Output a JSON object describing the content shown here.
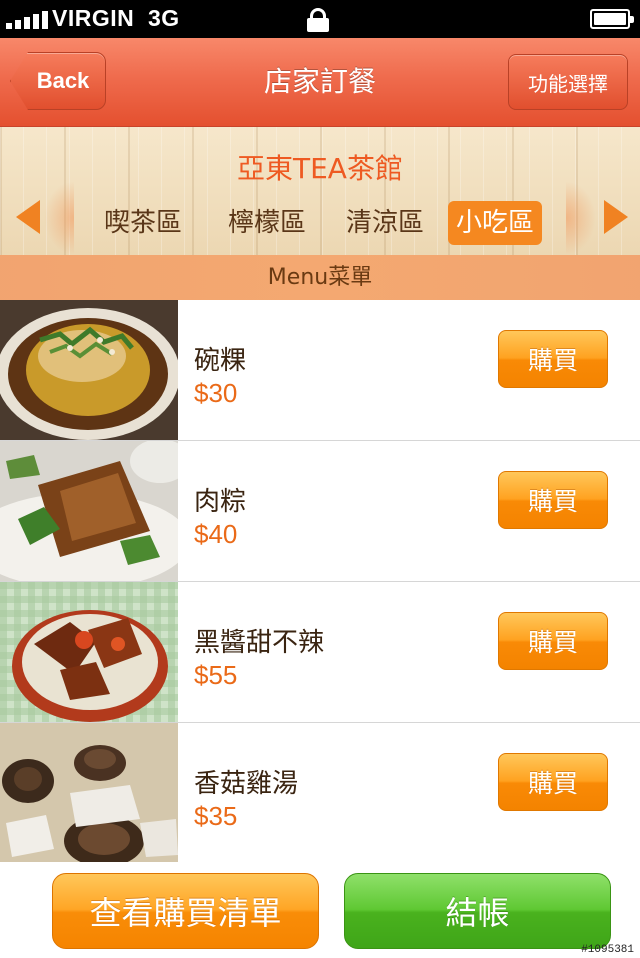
{
  "status_bar": {
    "carrier": "VIRGIN",
    "network": "3G"
  },
  "nav": {
    "back_label": "Back",
    "title": "店家訂餐",
    "function_label": "功能選擇"
  },
  "store": {
    "name": "亞東TEA茶館"
  },
  "categories": [
    {
      "label": "喫茶區",
      "active": false
    },
    {
      "label": "檸檬區",
      "active": false
    },
    {
      "label": "清涼區",
      "active": false
    },
    {
      "label": "小吃區",
      "active": true
    }
  ],
  "menu_header": "Menu菜單",
  "items": [
    {
      "name": "碗粿",
      "price": "$30",
      "buy_label": "購買"
    },
    {
      "name": "肉粽",
      "price": "$40",
      "buy_label": "購買"
    },
    {
      "name": "黑醬甜不辣",
      "price": "$55",
      "buy_label": "購買"
    },
    {
      "name": "香菇雞湯",
      "price": "$35",
      "buy_label": "購買"
    }
  ],
  "bottom": {
    "view_cart_label": "查看購買清單",
    "checkout_label": "結帳"
  },
  "watermark": "#1095381",
  "colors": {
    "nav": "#ef6b4d",
    "accent_orange": "#f58820",
    "price": "#ea6a18",
    "checkout_green": "#4ab21e"
  }
}
